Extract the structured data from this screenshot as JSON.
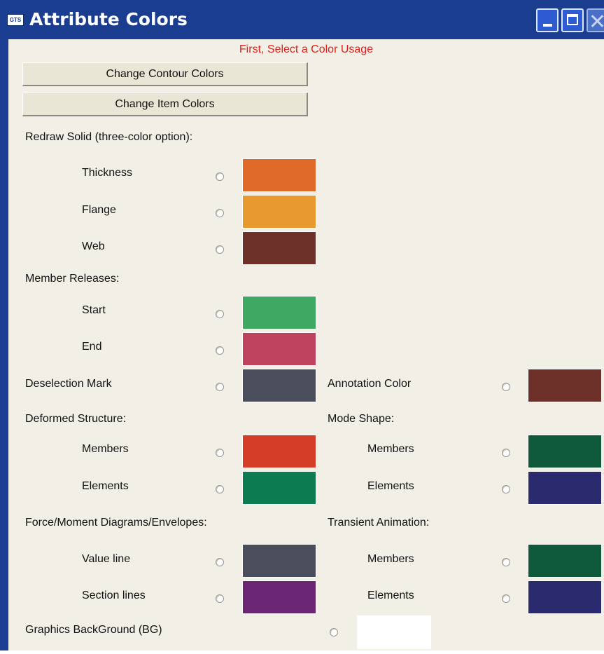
{
  "window": {
    "title": "Attribute Colors",
    "app_icon_text": "GTS"
  },
  "header_note": "First, Select a Color Usage",
  "buttons": {
    "contour": "Change Contour Colors",
    "item": "Change Item Colors"
  },
  "sections": {
    "redraw_solid": "Redraw Solid (three-color option):",
    "member_releases": "Member Releases:",
    "deselection_mark": "Deselection Mark",
    "annotation_color": "Annotation Color",
    "deformed_structure": "Deformed Structure:",
    "mode_shape": "Mode Shape:",
    "force_moment": "Force/Moment Diagrams/Envelopes:",
    "transient_animation": "Transient Animation:",
    "graphics_background": "Graphics BackGround (BG)"
  },
  "items": {
    "thickness": "Thickness",
    "flange": "Flange",
    "web": "Web",
    "start": "Start",
    "end": "End",
    "deformed_members": "Members",
    "deformed_elements": "Elements",
    "mode_members": "Members",
    "mode_elements": "Elements",
    "value_line": "Value line",
    "section_lines": "Section lines",
    "transient_members": "Members",
    "transient_elements": "Elements"
  },
  "colors": {
    "thickness": "#e06a28",
    "flange": "#e69a30",
    "web": "#6e3129",
    "start": "#3fa862",
    "end": "#bf435f",
    "deselection_mark": "#4a4d5c",
    "annotation_color": "#6e3129",
    "deformed_members": "#d63d28",
    "deformed_elements": "#0d7b50",
    "mode_members": "#0f5a3a",
    "mode_elements": "#2b2a6e",
    "value_line": "#4a4d5c",
    "section_lines": "#6b2774",
    "transient_members": "#0f5a3a",
    "transient_elements": "#2b2a6e",
    "graphics_background": "#ffffff"
  }
}
